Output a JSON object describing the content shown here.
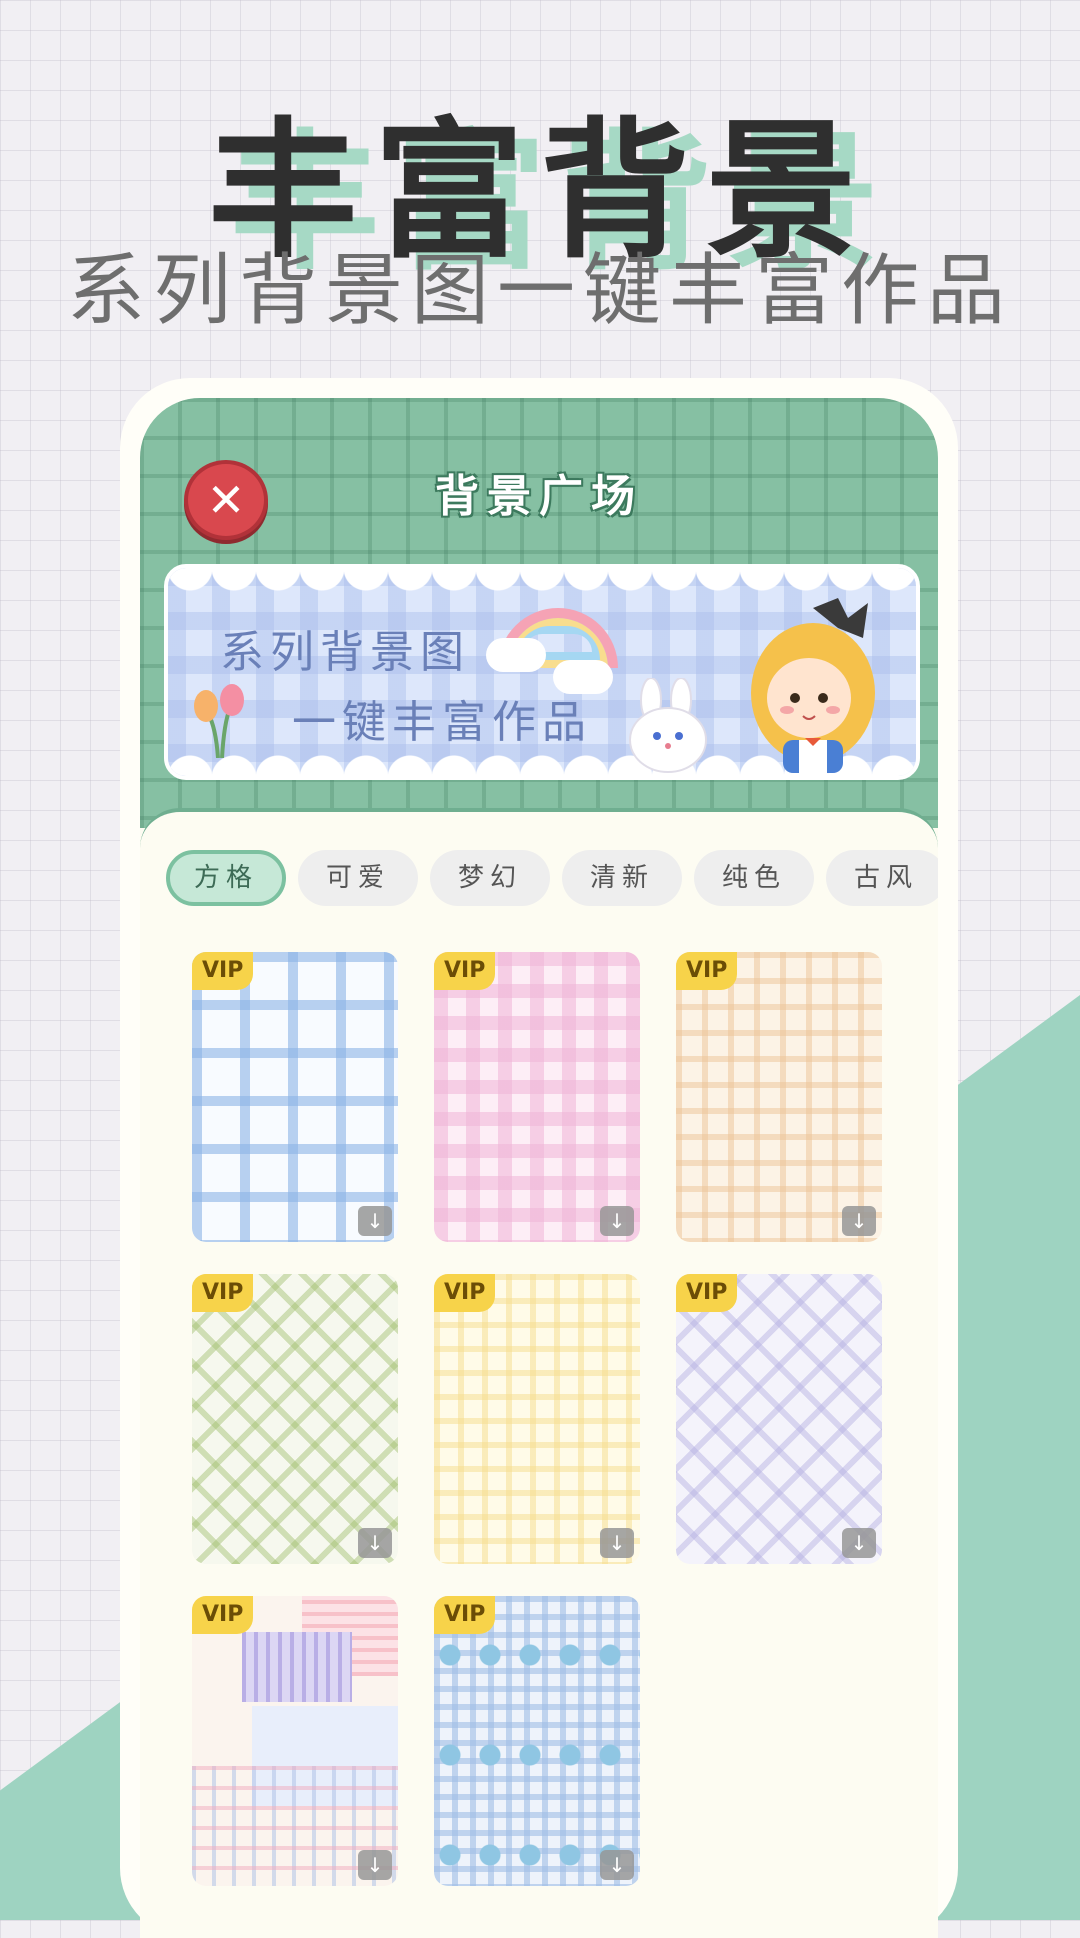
{
  "hero": {
    "title": "丰富背景",
    "subtitle": "系列背景图一键丰富作品"
  },
  "app": {
    "header_title": "背景广场",
    "close_icon": "close-icon",
    "banner": {
      "line1": "系列背景图",
      "line2": "一键丰富作品"
    },
    "tabs": [
      {
        "label": "方格",
        "active": true
      },
      {
        "label": "可爱",
        "active": false
      },
      {
        "label": "梦幻",
        "active": false
      },
      {
        "label": "清新",
        "active": false
      },
      {
        "label": "纯色",
        "active": false
      },
      {
        "label": "古风",
        "active": false
      }
    ],
    "cards": [
      {
        "badge": "VIP",
        "icon": "download-icon",
        "theme": "blue-plaid"
      },
      {
        "badge": "VIP",
        "icon": "download-icon",
        "theme": "pink-gingham"
      },
      {
        "badge": "VIP",
        "icon": "download-icon",
        "theme": "peach-plaid"
      },
      {
        "badge": "VIP",
        "icon": "download-icon",
        "theme": "green-argyle"
      },
      {
        "badge": "VIP",
        "icon": "download-icon",
        "theme": "yellow-plaid"
      },
      {
        "badge": "VIP",
        "icon": "download-icon",
        "theme": "lavender-argyle"
      },
      {
        "badge": "VIP",
        "icon": "download-icon",
        "theme": "pastel-patchwork"
      },
      {
        "badge": "VIP",
        "icon": "download-icon",
        "theme": "blue-cloud-gingham"
      }
    ]
  },
  "colors": {
    "accent_green": "#86c0a3",
    "active_tab": "#c6e8d7",
    "vip_badge": "#f7d34a",
    "close_red": "#d9484e"
  }
}
